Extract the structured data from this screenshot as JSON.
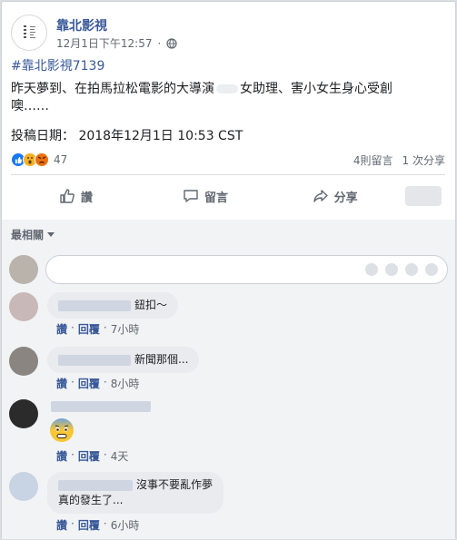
{
  "post": {
    "page_name": "靠北影視",
    "timestamp": "12月1日下午12:57",
    "hashtag": "#靠北影視7139",
    "text_part1": "昨天夢到、在拍馬拉松電影的大導演",
    "text_part2": "女助理、害小女生身心受創",
    "text_part3": "噢……",
    "date_line": "投稿日期： 2018年12月1日 10:53 CST"
  },
  "stats": {
    "reaction_count": "47",
    "comments": "4則留言",
    "shares": "1 次分享"
  },
  "actions": {
    "like": "讚",
    "comment": "留言",
    "share": "分享"
  },
  "comments_section": {
    "filter_label": "最相關",
    "action_like": "讚",
    "action_reply": "回覆",
    "dot": "·",
    "items": [
      {
        "text": "鈕扣～",
        "time": "7小時"
      },
      {
        "text": "新聞那個...",
        "time": "8小時"
      },
      {
        "text": "",
        "time": "4天"
      },
      {
        "text": "沒事不要亂作夢",
        "text2": "真的發生了...",
        "time": "6小時"
      }
    ]
  },
  "colors": {
    "link": "#385898",
    "like_blue": "#1877f2"
  },
  "icons": {
    "globe": "globe-icon",
    "like": "thumbs-up-icon",
    "comment": "speech-bubble-icon",
    "share": "share-arrow-icon",
    "dropdown": "caret-down-icon"
  }
}
